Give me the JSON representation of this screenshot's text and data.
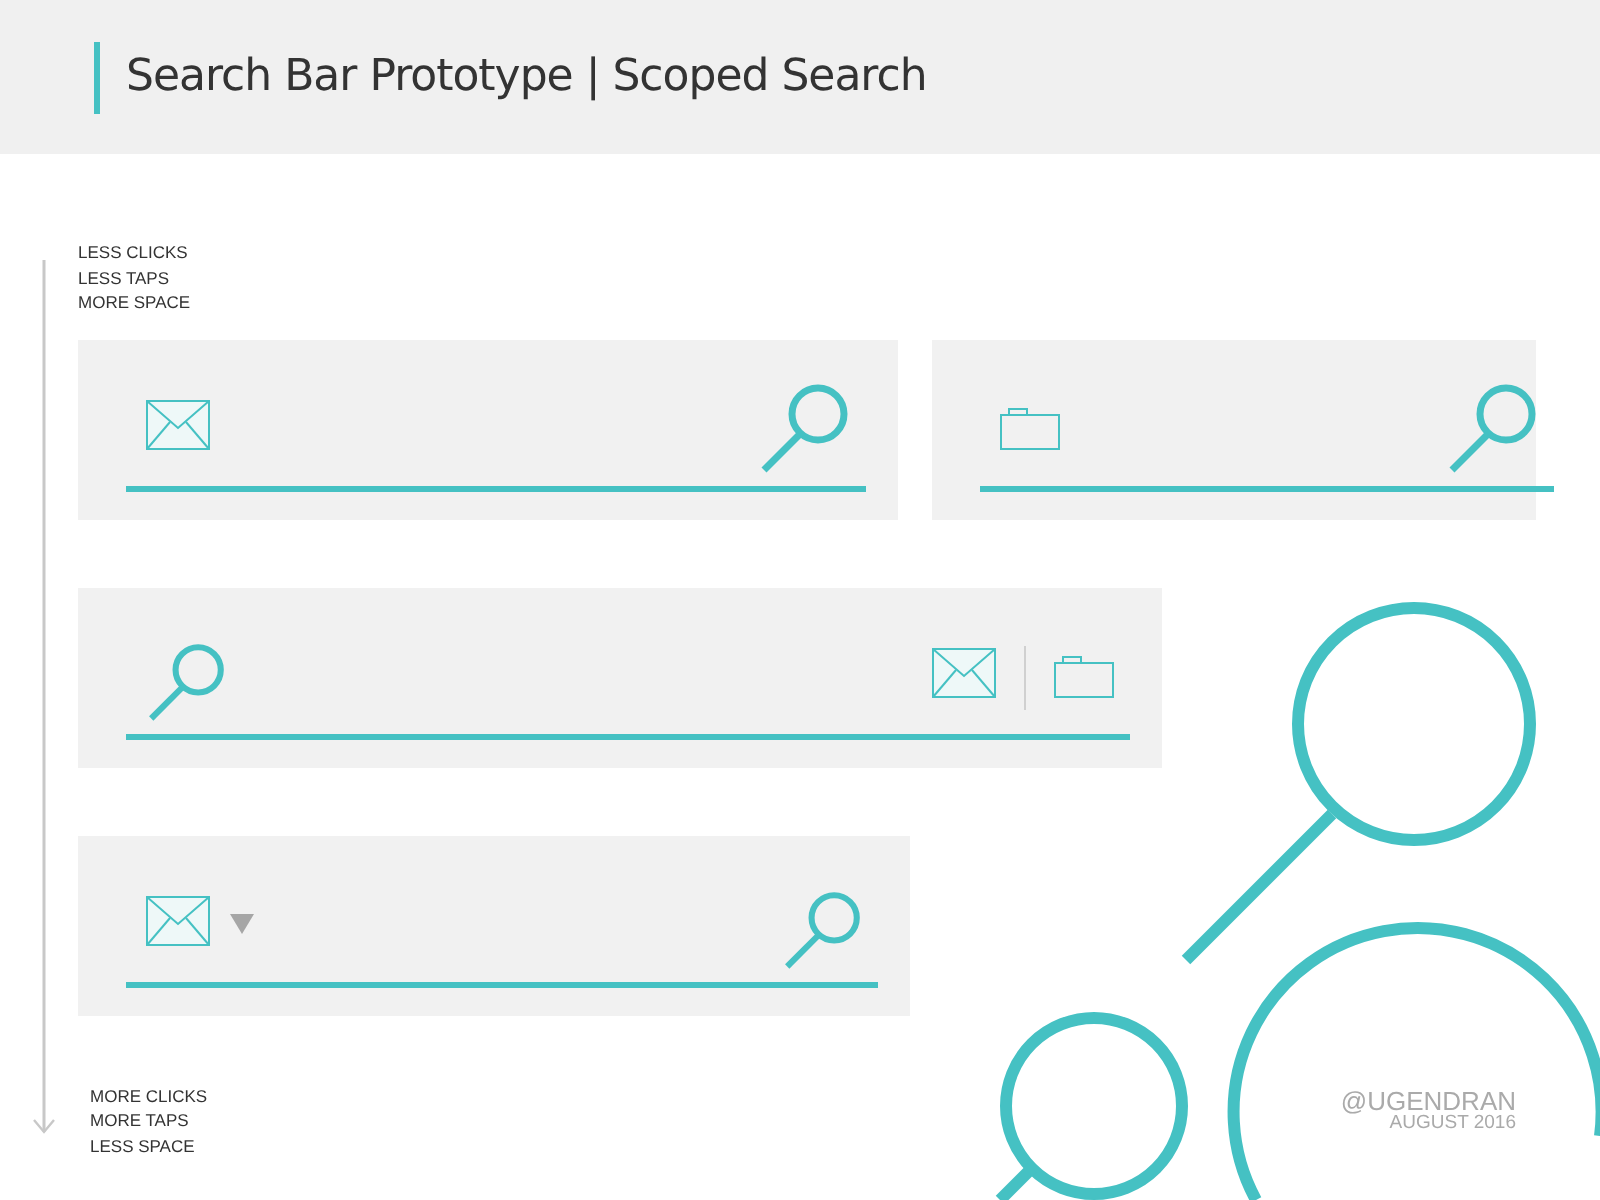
{
  "header": {
    "title": "Search Bar Prototype | Scoped Search"
  },
  "top_notes": [
    "LESS CLICKS",
    "LESS TAPS",
    "MORE SPACE"
  ],
  "rows": [
    {
      "bars": [
        {
          "kind": "mail"
        },
        {
          "kind": "folder"
        }
      ]
    },
    {
      "bars": [
        {
          "kind": "multi"
        }
      ]
    },
    {
      "bars": [
        {
          "kind": "dropdown"
        }
      ]
    }
  ],
  "bottom_notes": [
    "MORE CLICKS",
    "MORE TAPS",
    "LESS SPACE"
  ],
  "credit": {
    "handle": "@UGENDRAN",
    "date": "AUGUST 2016"
  }
}
